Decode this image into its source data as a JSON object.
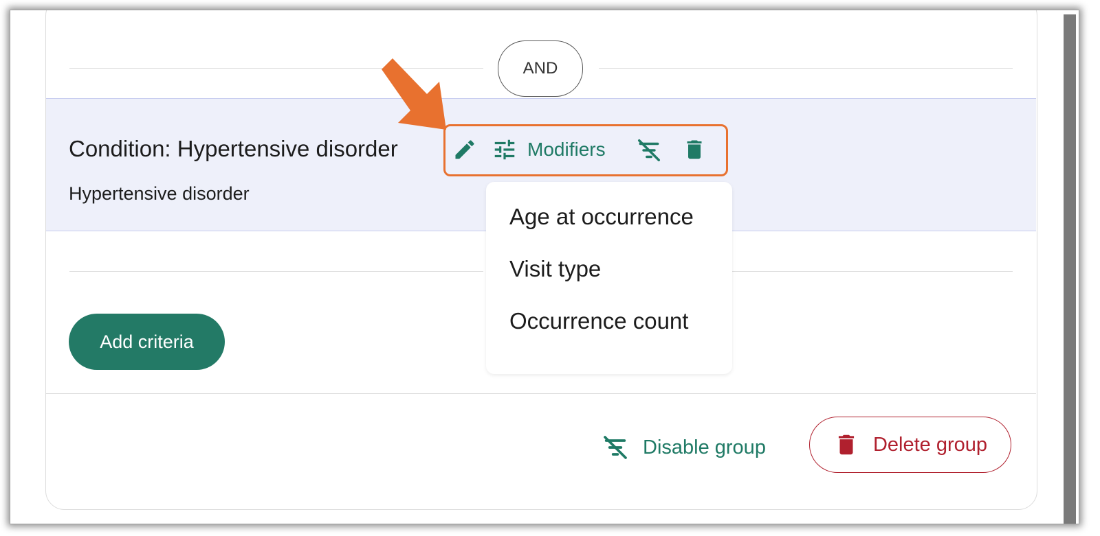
{
  "group": {
    "operator_label": "AND",
    "criterion": {
      "title": "Condition: Hypertensive disorder",
      "subtitle": "Hypertensive disorder",
      "toolbar": {
        "modifiers_label": "Modifiers",
        "icons": [
          "edit-icon",
          "tune-icon",
          "filter-off-icon",
          "delete-icon"
        ]
      }
    },
    "modifiers_menu": {
      "items": [
        "Age at occurrence",
        "Visit type",
        "Occurrence count"
      ]
    },
    "add_criteria_label": "Add criteria",
    "footer": {
      "disable_label": "Disable group",
      "delete_label": "Delete group"
    }
  },
  "colors": {
    "accent": "#237a66",
    "danger": "#b0202e",
    "highlight": "#e8712f",
    "selected_row": "#eef0fa"
  }
}
